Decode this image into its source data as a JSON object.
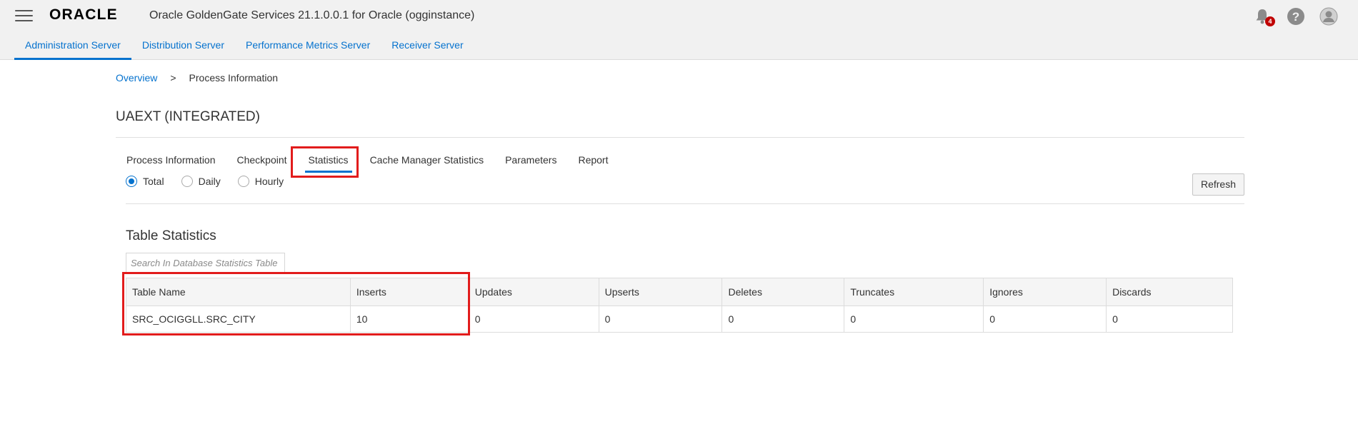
{
  "header": {
    "logo_text": "ORACLE",
    "app_title": "Oracle GoldenGate Services 21.1.0.0.1 for Oracle (ogginstance)",
    "notification_count": "4",
    "servers": [
      {
        "label": "Administration Server",
        "active": true
      },
      {
        "label": "Distribution Server",
        "active": false
      },
      {
        "label": "Performance Metrics Server",
        "active": false
      },
      {
        "label": "Receiver Server",
        "active": false
      }
    ],
    "icons": [
      "menu-icon",
      "bell-icon",
      "help-icon",
      "user-icon"
    ]
  },
  "breadcrumb": {
    "overview": "Overview",
    "separator": ">",
    "current": "Process Information"
  },
  "page_title": "UAEXT (INTEGRATED)",
  "sub_tabs": [
    {
      "label": "Process Information",
      "active": false
    },
    {
      "label": "Checkpoint",
      "active": false
    },
    {
      "label": "Statistics",
      "active": true
    },
    {
      "label": "Cache Manager Statistics",
      "active": false
    },
    {
      "label": "Parameters",
      "active": false
    },
    {
      "label": "Report",
      "active": false
    }
  ],
  "period_options": [
    {
      "label": "Total",
      "checked": true
    },
    {
      "label": "Daily",
      "checked": false
    },
    {
      "label": "Hourly",
      "checked": false
    }
  ],
  "refresh_label": "Refresh",
  "table_statistics": {
    "title": "Table Statistics",
    "search_placeholder": "Search In Database Statistics Table",
    "columns": [
      "Table Name",
      "Inserts",
      "Updates",
      "Upserts",
      "Deletes",
      "Truncates",
      "Ignores",
      "Discards"
    ],
    "rows": [
      [
        "SRC_OCIGGLL.SRC_CITY",
        "10",
        "0",
        "0",
        "0",
        "0",
        "0",
        "0"
      ]
    ]
  },
  "colors": {
    "accent": "#0572ce",
    "highlight": "#e21c1c",
    "badge": "#c00000"
  }
}
